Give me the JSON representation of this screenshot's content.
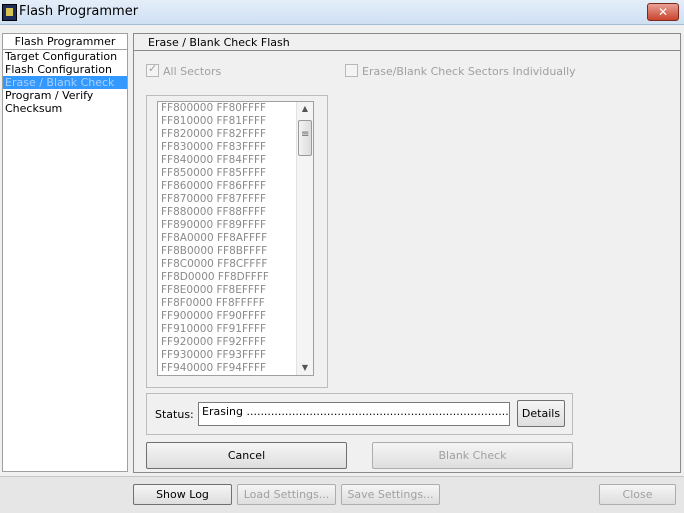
{
  "window": {
    "title": "Flash Programmer",
    "close_label": "✕"
  },
  "nav": {
    "header": "Flash Programmer",
    "items": [
      {
        "label": "Target Configuration"
      },
      {
        "label": "Flash Configuration"
      },
      {
        "label": "Erase / Blank Check"
      },
      {
        "label": "Program / Verify"
      },
      {
        "label": "Checksum"
      }
    ]
  },
  "panel": {
    "title": "Erase / Blank Check Flash",
    "all_sectors_label": "All Sectors",
    "individual_label": "Erase/Blank Check Sectors Individually",
    "sectors": [
      "FF800000  FF80FFFF",
      "FF810000  FF81FFFF",
      "FF820000  FF82FFFF",
      "FF830000  FF83FFFF",
      "FF840000  FF84FFFF",
      "FF850000  FF85FFFF",
      "FF860000  FF86FFFF",
      "FF870000  FF87FFFF",
      "FF880000  FF88FFFF",
      "FF890000  FF89FFFF",
      "FF8A0000  FF8AFFFF",
      "FF8B0000  FF8BFFFF",
      "FF8C0000  FF8CFFFF",
      "FF8D0000  FF8DFFFF",
      "FF8E0000  FF8EFFFF",
      "FF8F0000  FF8FFFFF",
      "FF900000  FF90FFFF",
      "FF910000  FF91FFFF",
      "FF920000  FF92FFFF",
      "FF930000  FF93FFFF",
      "FF940000  FF94FFFF"
    ],
    "status_label": "Status:",
    "status_value": "Erasing .................................................................................",
    "details_label": "Details",
    "cancel_label": "Cancel",
    "blank_check_label": "Blank Check"
  },
  "footer": {
    "show_log_label": "Show Log",
    "load_settings_label": "Load Settings...",
    "save_settings_label": "Save Settings...",
    "close_label": "Close"
  }
}
